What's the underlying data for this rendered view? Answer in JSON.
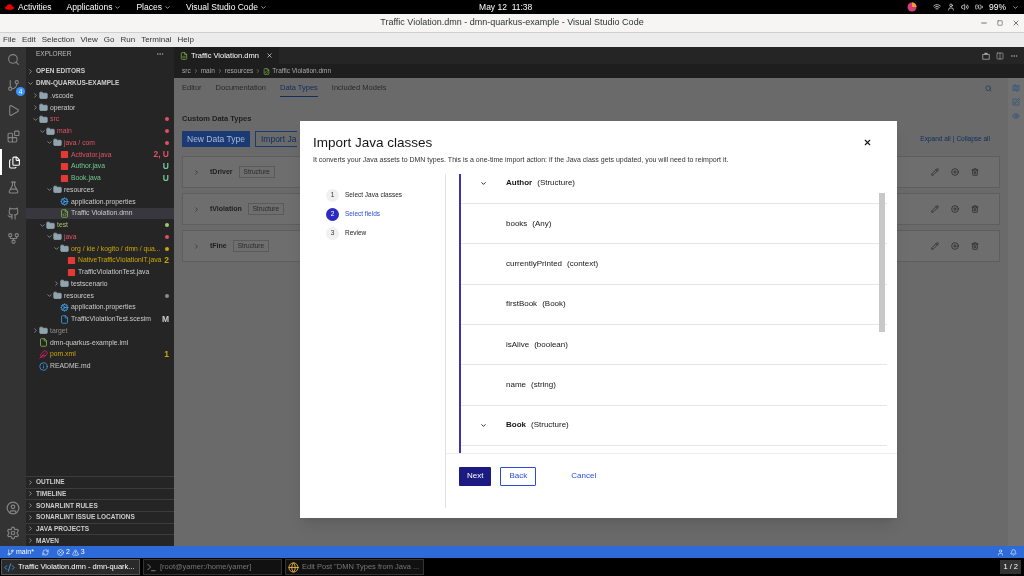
{
  "top_bar": {
    "activities": "Activities",
    "menus": [
      "Applications",
      "Places",
      "Visual Studio Code"
    ],
    "clock": "May 12  11:38",
    "battery": "99%"
  },
  "window": {
    "title": "Traffic Violation.dmn - dmn-quarkus-example - Visual Studio Code"
  },
  "menu_bar": [
    "File",
    "Edit",
    "Selection",
    "View",
    "Go",
    "Run",
    "Terminal",
    "Help"
  ],
  "activity_bar": {
    "items": [
      {
        "kind": "search",
        "selected": false
      },
      {
        "kind": "source-control",
        "selected": false,
        "badge": "4"
      },
      {
        "kind": "run",
        "selected": false
      },
      {
        "kind": "extensions",
        "selected": false
      },
      {
        "kind": "explorer",
        "selected": true
      },
      {
        "kind": "testing",
        "selected": false
      },
      {
        "kind": "github",
        "selected": false
      },
      {
        "kind": "git-graph",
        "selected": false
      }
    ],
    "bottom": [
      {
        "kind": "account"
      },
      {
        "kind": "settings"
      }
    ]
  },
  "explorer": {
    "title": "EXPLORER",
    "open_editors": {
      "label": "OPEN EDITORS",
      "expanded": false
    },
    "project": {
      "label": "DMN-QUARKUS-EXAMPLE",
      "expanded": true
    },
    "tree": [
      {
        "name": ".vscode",
        "kind": "folder",
        "expanded": false,
        "selected": false
      },
      {
        "name": "operator",
        "kind": "folder",
        "expanded": false,
        "selected": false
      },
      {
        "name": "src",
        "kind": "folder",
        "expanded": true,
        "selected": false,
        "color": "#e05263",
        "children": [
          {
            "name": "main",
            "kind": "folder",
            "expanded": true,
            "selected": false,
            "color": "#e05263",
            "children": [
              {
                "name": "java / com",
                "kind": "folder",
                "expanded": true,
                "selected": false,
                "color": "#e05263",
                "children": [
                  {
                    "name": "Activator.java",
                    "kind": "java",
                    "selected": false,
                    "color": "#e05263",
                    "badge": "2, U"
                  },
                  {
                    "name": "Author.java",
                    "kind": "java",
                    "selected": false,
                    "color": "#73c991",
                    "badge": "U"
                  },
                  {
                    "name": "Book.java",
                    "kind": "java",
                    "selected": false,
                    "color": "#73c991",
                    "badge": "U"
                  }
                ]
              },
              {
                "name": "resources",
                "kind": "folder",
                "expanded": true,
                "selected": false,
                "children": [
                  {
                    "name": "application.properties",
                    "kind": "properties",
                    "selected": false
                  },
                  {
                    "name": "Traffic Violation.dmn",
                    "kind": "dmn",
                    "selected": true
                  }
                ]
              }
            ]
          },
          {
            "name": "test",
            "kind": "folder",
            "expanded": true,
            "selected": false,
            "color": "#a3c46b",
            "children": [
              {
                "name": "java",
                "kind": "folder",
                "expanded": true,
                "selected": false,
                "color": "#e05263",
                "children": [
                  {
                    "name": "org / kie / kogito / dmn / qua...",
                    "kind": "folder",
                    "expanded": true,
                    "selected": false,
                    "color": "#cca700",
                    "children": [
                      {
                        "name": "NativeTrafficViolationIT.java",
                        "kind": "java",
                        "selected": false,
                        "color": "#cca700",
                        "badge": "2"
                      },
                      {
                        "name": "TrafficViolationTest.java",
                        "kind": "java",
                        "selected": false
                      }
                    ]
                  },
                  {
                    "name": "testscenario",
                    "kind": "folder",
                    "expanded": false,
                    "selected": false
                  }
                ]
              },
              {
                "name": "resources",
                "kind": "folder",
                "expanded": true,
                "selected": false,
                "color": "#8c8c8c",
                "children": [
                  {
                    "name": "application.properties",
                    "kind": "properties",
                    "selected": false
                  },
                  {
                    "name": "TrafficViolationTest.scesim",
                    "kind": "scesim",
                    "selected": false,
                    "badge": "M"
                  }
                ]
              }
            ]
          }
        ]
      },
      {
        "name": "target",
        "kind": "folder",
        "expanded": false,
        "selected": false,
        "dimmed": true
      },
      {
        "name": "dmn-quarkus-example.iml",
        "kind": "iml",
        "selected": false
      },
      {
        "name": "pom.xml",
        "kind": "xml",
        "selected": false,
        "color": "#cca700",
        "badge": "1"
      },
      {
        "name": "README.md",
        "kind": "md",
        "selected": false
      }
    ],
    "panels": [
      {
        "label": "OUTLINE",
        "expanded": false
      },
      {
        "label": "TIMELINE",
        "expanded": false
      },
      {
        "label": "SONARLINT RULES",
        "expanded": false
      },
      {
        "label": "SONARLINT ISSUE LOCATIONS",
        "expanded": false
      },
      {
        "label": "JAVA PROJECTS",
        "expanded": false
      },
      {
        "label": "MAVEN",
        "expanded": false
      }
    ]
  },
  "editor": {
    "tabs": [
      {
        "label": "Traffic Violation.dmn",
        "selected": true
      }
    ],
    "breadcrumbs": [
      "src",
      "main",
      "resources",
      "Traffic Violation.dmn"
    ],
    "dmn_tabs": [
      {
        "label": "Editor",
        "selected": false
      },
      {
        "label": "Documentation",
        "selected": false
      },
      {
        "label": "Data Types",
        "selected": true
      },
      {
        "label": "Included Models",
        "selected": false
      }
    ],
    "section_title": "Custom Data Types",
    "new_button": "New Data Type",
    "import_button": "Import Ja",
    "expand_all": "Expand all",
    "separator": "|",
    "collapse_all": "Collapse all",
    "types": [
      {
        "name": "tDriver",
        "badge": "Structure"
      },
      {
        "name": "tViolation",
        "badge": "Structure"
      },
      {
        "name": "tFine",
        "badge": "Structure"
      }
    ]
  },
  "dialog": {
    "title": "Import Java classes",
    "description": "It converts your Java assets to DMN types. This is a one-time import action: if the Java class gets updated, you will need to reimport it.",
    "steps": [
      {
        "number": "1",
        "label": "Select Java classes",
        "selected": false
      },
      {
        "number": "2",
        "label": "Select fields",
        "selected": true
      },
      {
        "number": "3",
        "label": "Review",
        "selected": false
      }
    ],
    "fields": [
      {
        "kind": "structure",
        "name": "Author",
        "type": "(Structure)"
      },
      {
        "kind": "field",
        "name": "books",
        "type": "(Any)"
      },
      {
        "kind": "field",
        "name": "currentlyPrinted",
        "type": "(context)"
      },
      {
        "kind": "field",
        "name": "firstBook",
        "type": "(Book)"
      },
      {
        "kind": "field",
        "name": "isAlive",
        "type": "(boolean)"
      },
      {
        "kind": "field",
        "name": "name",
        "type": "(string)"
      },
      {
        "kind": "structure",
        "name": "Book",
        "type": "(Structure)"
      }
    ],
    "buttons": {
      "next": "Next",
      "back": "Back",
      "cancel": "Cancel"
    }
  },
  "status_bar": {
    "branch": "main*",
    "errors": "2",
    "warnings": "3"
  },
  "taskbar": [
    {
      "label": "Traffic Violation.dmn - dmn-quark...",
      "kind": "vscode",
      "selected": true
    },
    {
      "label": "[root@yamer:/home/yamer]",
      "kind": "terminal",
      "selected": false
    },
    {
      "label": "Edit Post \"DMN Types from Java ...",
      "kind": "browser",
      "selected": false
    }
  ],
  "workspace": "1 / 2"
}
